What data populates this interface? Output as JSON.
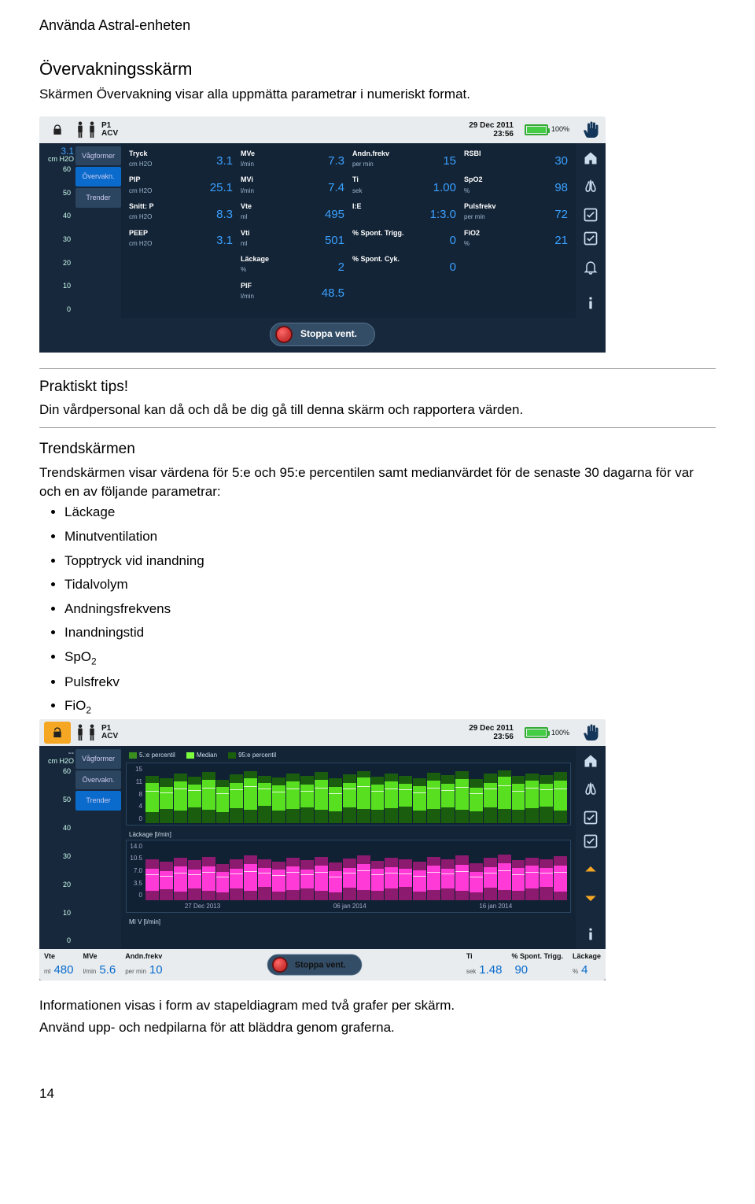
{
  "doc": {
    "header": "Använda Astral-enheten",
    "h2": "Övervakningsskärm",
    "intro": "Skärmen Övervakning visar alla uppmätta parametrar i numeriskt format.",
    "tips_heading": "Praktiskt tips!",
    "tips_body": "Din vårdpersonal kan då och då be dig gå till denna skärm och rapportera värden.",
    "trend_h": "Trendskärmen",
    "trend_body": "Trendskärmen visar värdena för 5:e och 95:e percentilen samt medianvärdet för de senaste 30 dagarna för var och en av följande parametrar:",
    "param_list": [
      "Läckage",
      "Minutventilation",
      "Topptryck vid inandning",
      "Tidalvolym",
      "Andningsfrekvens",
      "Inandningstid",
      "SpO",
      "Pulsfrekv",
      "FiO"
    ],
    "after1": "Informationen visas i form av stapeldiagram med två grafer per skärm.",
    "after2": "Använd upp- och nedpilarna för att bläddra genom graferna.",
    "pagenum": "14"
  },
  "topbar": {
    "prog_line1": "P1",
    "prog_line2": "ACV",
    "date_line1": "29 Dec 2011",
    "date_line2": "23:56",
    "battery_pct": "100%"
  },
  "tabs": {
    "waveforms": "Vågformer",
    "monitor": "Övervakn.",
    "trends": "Trender"
  },
  "yaxis": {
    "val": "3.1",
    "unit": "cm H2O",
    "ticks": [
      "60",
      "50",
      "40",
      "30",
      "20",
      "10",
      "0"
    ]
  },
  "yaxis2": {
    "val": "--",
    "unit": "cm H2O",
    "ticks": [
      "60",
      "50",
      "40",
      "30",
      "20",
      "10",
      "0"
    ]
  },
  "params": [
    {
      "lbl": "Tryck",
      "unit": "cm H2O",
      "val": "3.1"
    },
    {
      "lbl": "MVe",
      "unit": "l/min",
      "val": "7.3"
    },
    {
      "lbl": "Andn.frekv",
      "unit": "per min",
      "val": "15"
    },
    {
      "lbl": "RSBI",
      "unit": "",
      "val": "30"
    },
    {
      "lbl": "PIP",
      "unit": "cm H2O",
      "val": "25.1"
    },
    {
      "lbl": "MVi",
      "unit": "l/min",
      "val": "7.4"
    },
    {
      "lbl": "Ti",
      "unit": "sek",
      "val": "1.00"
    },
    {
      "lbl": "SpO2",
      "unit": "%",
      "val": "98"
    },
    {
      "lbl": "Snitt: P",
      "unit": "cm H2O",
      "val": "8.3"
    },
    {
      "lbl": "Vte",
      "unit": "ml",
      "val": "495"
    },
    {
      "lbl": "I:E",
      "unit": "",
      "val": "1:3.0"
    },
    {
      "lbl": "Pulsfrekv",
      "unit": "per min",
      "val": "72"
    },
    {
      "lbl": "PEEP",
      "unit": "cm H2O",
      "val": "3.1"
    },
    {
      "lbl": "Vti",
      "unit": "ml",
      "val": "501"
    },
    {
      "lbl": "% Spont. Trigg.",
      "unit": "",
      "val": "0"
    },
    {
      "lbl": "FiO2",
      "unit": "%",
      "val": "21"
    },
    {
      "lbl": "",
      "unit": "",
      "val": ""
    },
    {
      "lbl": "Läckage",
      "unit": "%",
      "val": "2"
    },
    {
      "lbl": "% Spont. Cyk.",
      "unit": "",
      "val": "0"
    },
    {
      "lbl": "",
      "unit": "",
      "val": ""
    },
    {
      "lbl": "",
      "unit": "",
      "val": ""
    },
    {
      "lbl": "PIF",
      "unit": "l/min",
      "val": "48.5"
    },
    {
      "lbl": "",
      "unit": "",
      "val": ""
    },
    {
      "lbl": "",
      "unit": "",
      "val": ""
    }
  ],
  "stop_label": "Stoppa vent.",
  "chart_data": [
    {
      "type": "bar",
      "title": "",
      "ylabels": [
        "15",
        "11",
        "8",
        "4",
        "0"
      ],
      "legend": {
        "p5": "5.:e percentil",
        "median": "Median",
        "p95": "95:e percentil"
      },
      "color": "green",
      "bars": [
        {
          "lo": 20,
          "hi": 82,
          "med": 55
        },
        {
          "lo": 25,
          "hi": 78,
          "med": 52
        },
        {
          "lo": 22,
          "hi": 85,
          "med": 58
        },
        {
          "lo": 28,
          "hi": 80,
          "med": 56
        },
        {
          "lo": 24,
          "hi": 88,
          "med": 60
        },
        {
          "lo": 20,
          "hi": 75,
          "med": 50
        },
        {
          "lo": 26,
          "hi": 84,
          "med": 57
        },
        {
          "lo": 23,
          "hi": 90,
          "med": 62
        },
        {
          "lo": 30,
          "hi": 82,
          "med": 58
        },
        {
          "lo": 22,
          "hi": 79,
          "med": 53
        },
        {
          "lo": 25,
          "hi": 86,
          "med": 59
        },
        {
          "lo": 27,
          "hi": 81,
          "med": 55
        },
        {
          "lo": 24,
          "hi": 88,
          "med": 60
        },
        {
          "lo": 21,
          "hi": 77,
          "med": 51
        },
        {
          "lo": 28,
          "hi": 84,
          "med": 58
        },
        {
          "lo": 25,
          "hi": 90,
          "med": 63
        },
        {
          "lo": 23,
          "hi": 80,
          "med": 54
        },
        {
          "lo": 26,
          "hi": 85,
          "med": 59
        },
        {
          "lo": 29,
          "hi": 82,
          "med": 57
        },
        {
          "lo": 22,
          "hi": 78,
          "med": 52
        },
        {
          "lo": 25,
          "hi": 87,
          "med": 60
        },
        {
          "lo": 27,
          "hi": 83,
          "med": 56
        },
        {
          "lo": 24,
          "hi": 89,
          "med": 61
        },
        {
          "lo": 21,
          "hi": 76,
          "med": 50
        },
        {
          "lo": 28,
          "hi": 85,
          "med": 58
        },
        {
          "lo": 25,
          "hi": 91,
          "med": 64
        },
        {
          "lo": 23,
          "hi": 81,
          "med": 55
        },
        {
          "lo": 26,
          "hi": 86,
          "med": 60
        },
        {
          "lo": 29,
          "hi": 83,
          "med": 57
        },
        {
          "lo": 22,
          "hi": 88,
          "med": 59
        }
      ]
    },
    {
      "type": "bar",
      "title": "Läckage [l/min]",
      "ylabels": [
        "14.0",
        "10.5",
        "7.0",
        "3.5",
        "0"
      ],
      "xdates": [
        "27 Dec 2013",
        "06 jan 2014",
        "16 jan 2014"
      ],
      "color": "pink",
      "bars": [
        {
          "lo": 15,
          "hi": 70,
          "med": 42
        },
        {
          "lo": 18,
          "hi": 65,
          "med": 40
        },
        {
          "lo": 14,
          "hi": 72,
          "med": 45
        },
        {
          "lo": 20,
          "hi": 68,
          "med": 43
        },
        {
          "lo": 16,
          "hi": 74,
          "med": 46
        },
        {
          "lo": 13,
          "hi": 62,
          "med": 38
        },
        {
          "lo": 19,
          "hi": 70,
          "med": 44
        },
        {
          "lo": 15,
          "hi": 76,
          "med": 48
        },
        {
          "lo": 22,
          "hi": 69,
          "med": 45
        },
        {
          "lo": 14,
          "hi": 66,
          "med": 41
        },
        {
          "lo": 17,
          "hi": 73,
          "med": 46
        },
        {
          "lo": 20,
          "hi": 68,
          "med": 43
        },
        {
          "lo": 16,
          "hi": 74,
          "med": 47
        },
        {
          "lo": 13,
          "hi": 64,
          "med": 39
        },
        {
          "lo": 21,
          "hi": 71,
          "med": 45
        },
        {
          "lo": 17,
          "hi": 77,
          "med": 49
        },
        {
          "lo": 15,
          "hi": 67,
          "med": 42
        },
        {
          "lo": 19,
          "hi": 72,
          "med": 46
        },
        {
          "lo": 22,
          "hi": 69,
          "med": 44
        },
        {
          "lo": 14,
          "hi": 65,
          "med": 40
        },
        {
          "lo": 17,
          "hi": 74,
          "med": 47
        },
        {
          "lo": 20,
          "hi": 70,
          "med": 44
        },
        {
          "lo": 16,
          "hi": 76,
          "med": 48
        },
        {
          "lo": 13,
          "hi": 63,
          "med": 38
        },
        {
          "lo": 21,
          "hi": 72,
          "med": 46
        },
        {
          "lo": 17,
          "hi": 78,
          "med": 50
        },
        {
          "lo": 15,
          "hi": 68,
          "med": 43
        },
        {
          "lo": 19,
          "hi": 73,
          "med": 47
        },
        {
          "lo": 22,
          "hi": 70,
          "med": 45
        },
        {
          "lo": 14,
          "hi": 75,
          "med": 46
        }
      ]
    },
    {
      "type": "bar",
      "title": "MI V [l/min]",
      "ylabels": [],
      "color": "green",
      "bars": []
    }
  ],
  "readout": [
    {
      "lbl": "Vte",
      "unit": "ml",
      "val": "480"
    },
    {
      "lbl": "MVe",
      "unit": "l/min",
      "val": "5.6"
    },
    {
      "lbl": "Andn.frekv",
      "unit": "per min",
      "val": "10"
    },
    {
      "lbl": "Ti",
      "unit": "sek",
      "val": "1.48"
    },
    {
      "lbl": "% Spont. Trigg.",
      "unit": "",
      "val": "90"
    },
    {
      "lbl": "Läckage",
      "unit": "%",
      "val": "4"
    }
  ]
}
